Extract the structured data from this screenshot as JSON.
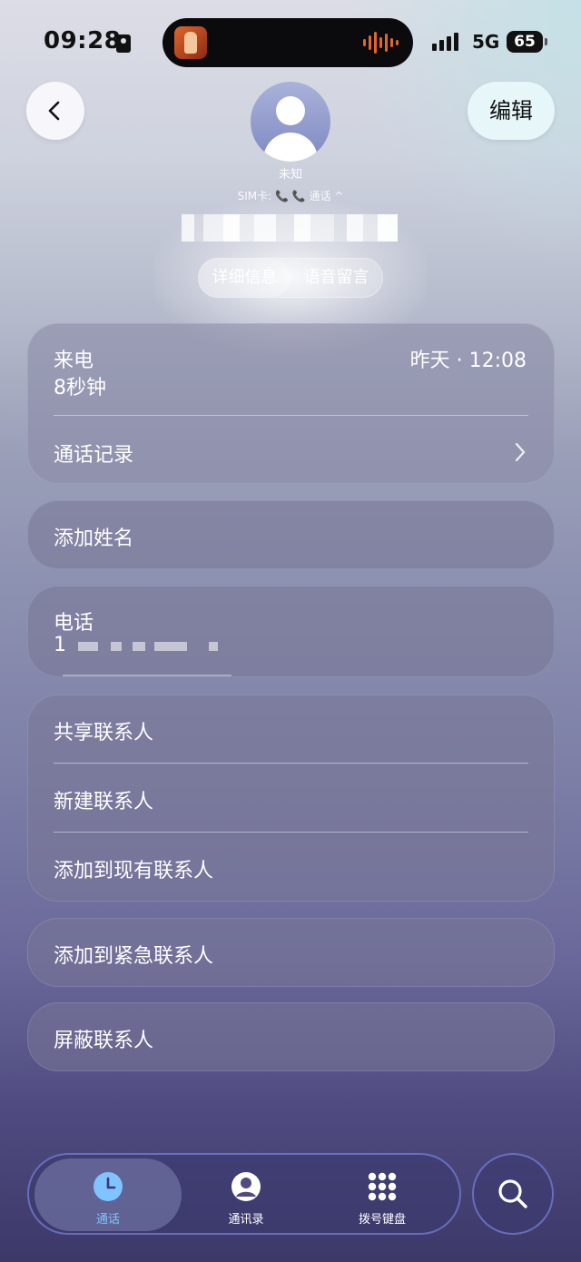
{
  "status_bar": {
    "time": "09:28",
    "network": "5G",
    "battery": "65"
  },
  "header": {
    "edit_label": "编辑",
    "contact_label": "未知",
    "sim_line": "SIM卡: 📞 📞 通话 ^",
    "tabs": [
      {
        "label": "详细信息"
      },
      {
        "label": "语音留言"
      }
    ]
  },
  "call_card": {
    "type": "来电",
    "duration": "8秒钟",
    "time": "昨天 · 12:08",
    "history_label": "通话记录"
  },
  "name_card": {
    "label": "添加姓名"
  },
  "phone_card": {
    "label": "电话",
    "number_prefix": "1"
  },
  "actions": {
    "share": "共享联系人",
    "new_contact": "新建联系人",
    "add_existing": "添加到现有联系人",
    "add_emergency": "添加到紧急联系人",
    "block": "屏蔽联系人"
  },
  "bottom_nav": {
    "items": [
      {
        "label": "通话"
      },
      {
        "label": "通讯录"
      },
      {
        "label": "拨号键盘"
      }
    ]
  },
  "colors": {
    "active_nav": "#7fc4ff",
    "accent_border": "#8c96ff"
  }
}
